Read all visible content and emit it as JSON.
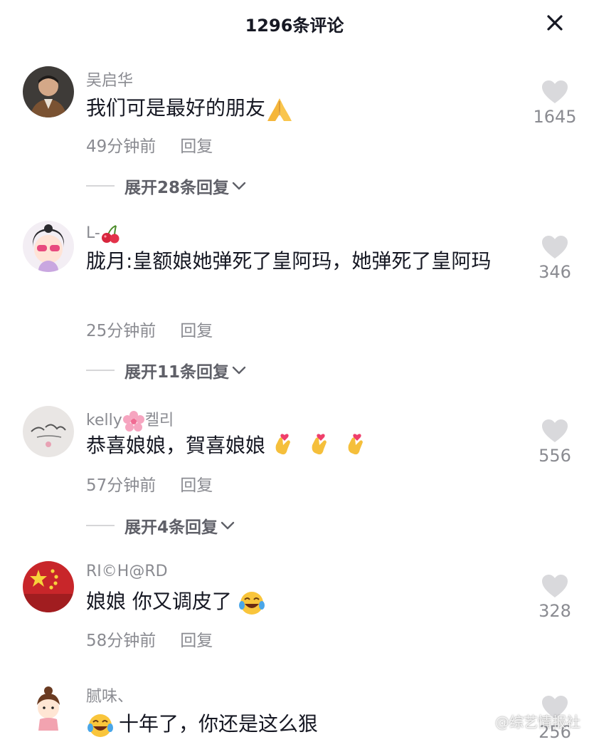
{
  "header": {
    "title": "1296条评论"
  },
  "comments": [
    {
      "username": "吴启华",
      "text": "我们可是最好的朋友",
      "time": "49分钟前",
      "reply_label": "回复",
      "likes": "1645",
      "expand_label": "展开28条回复"
    },
    {
      "username": "L-",
      "text": "胧月:皇额娘她弹死了皇阿玛，她弹死了皇阿玛",
      "time": "25分钟前",
      "reply_label": "回复",
      "likes": "346",
      "expand_label": "展开11条回复"
    },
    {
      "username": "kelly",
      "username_suffix": "켈리",
      "text": "恭喜娘娘，賀喜娘娘",
      "time": "57分钟前",
      "reply_label": "回复",
      "likes": "556",
      "expand_label": "展开4条回复"
    },
    {
      "username": "RI©H@RD",
      "text": "娘娘 你又调皮了",
      "time": "58分钟前",
      "reply_label": "回复",
      "likes": "328"
    },
    {
      "username": "腻味、",
      "text": "十年了，你还是这么狠",
      "likes": "256"
    }
  ],
  "watermark": "@综艺情报社",
  "colors": {
    "text": "#161823",
    "secondary": "#8a8b91",
    "heart": "#d9d9dc"
  }
}
